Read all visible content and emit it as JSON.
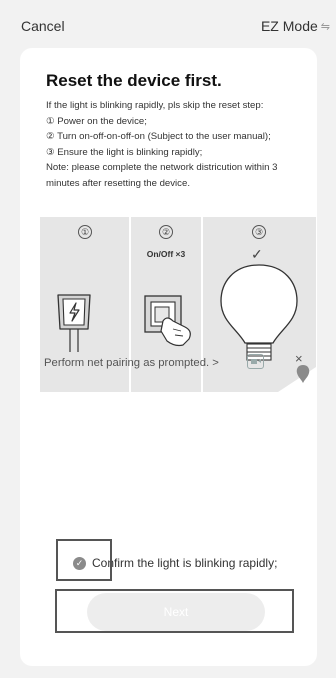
{
  "header": {
    "cancel_label": "Cancel",
    "mode_label": "EZ Mode",
    "mode_icon": "swap-icon"
  },
  "instructions": {
    "title": "Reset the device first.",
    "lines": [
      "If the light is blinking rapidly, pls skip the reset step:",
      "① Power on the device;",
      "② Turn on-off-on-off-on (Subject to the user manual);",
      "③ Ensure the light is blinking rapidly;",
      "Note: please complete the network districution within 3 minutes after resetting the device."
    ]
  },
  "illustration": {
    "steps": [
      "①",
      "②",
      "③"
    ],
    "step2_caption": "On/Off ×3",
    "step3_mark": "✓",
    "wrong_mark": "×"
  },
  "pairing_link": "Perform net pairing as prompted. >",
  "confirm_label": "Confirm the light is blinking rapidly;",
  "next_label": "Next",
  "colors": {
    "background": "#f2f2f2",
    "card": "#ffffff",
    "button_disabled": "#ededed",
    "checkbox": "#8a8a8a"
  }
}
